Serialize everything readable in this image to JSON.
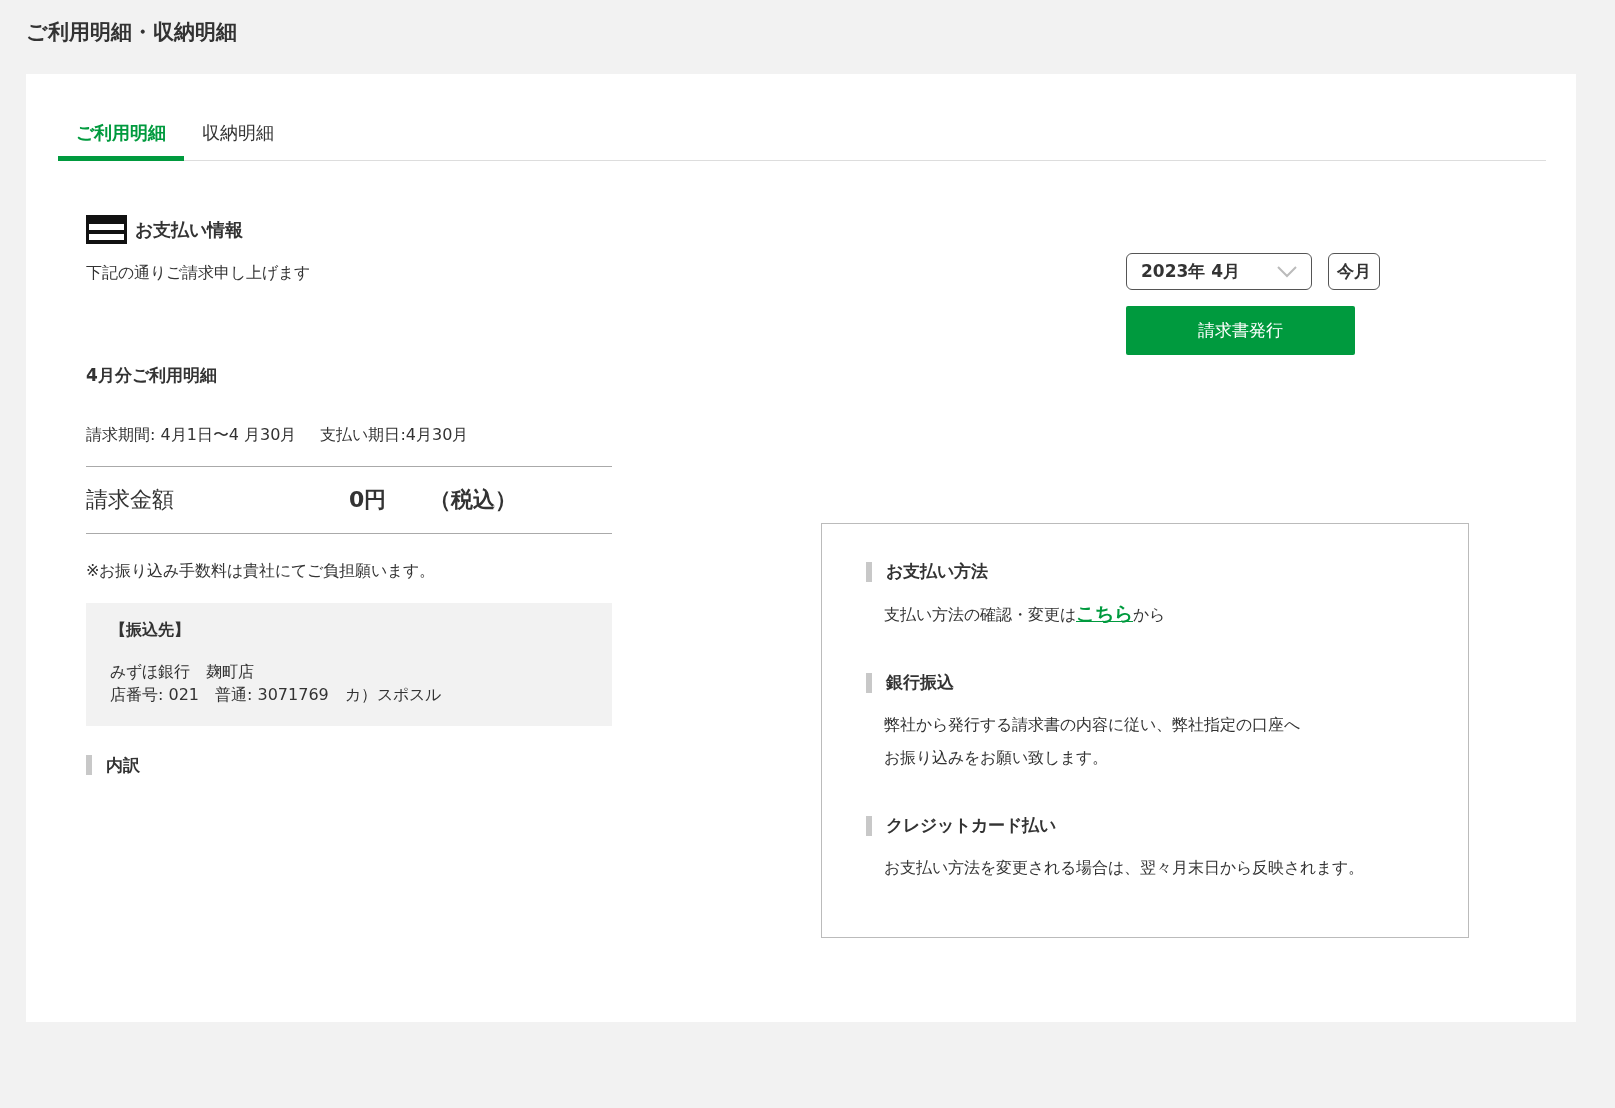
{
  "page_title": "ご利用明細・収納明細",
  "tabs": [
    {
      "label": "ご利用明細",
      "selected": true
    },
    {
      "label": "収納明細",
      "selected": false
    }
  ],
  "payment_info": {
    "heading": "お支払い情報",
    "subtitle": "下記の通りご請求申し上げます",
    "month_heading": "4月分ご利用明細",
    "period": "請求期間: 4月1日〜4 月30月",
    "due": "支払い期日:4月30月",
    "amount_label": "請求金額",
    "amount": "0円",
    "tax": "（税込）",
    "fee_note": "※お振り込み手数料は貴社にてご負担願います。",
    "transfer": {
      "heading": "【振込先】",
      "lines": [
        "みずほ銀行　麹町店",
        "店番号: 021　普通: 3071769　カ）スポスル"
      ]
    },
    "breakdown_heading": "内訳"
  },
  "controls": {
    "month_select": "2023年 4月",
    "this_month_button": "今月",
    "invoice_button": "請求書発行"
  },
  "methods": [
    {
      "heading": "お支払い方法",
      "kind": "link",
      "text_before": "支払い方法の確認・変更は",
      "link": "こちら",
      "text_after": "から"
    },
    {
      "heading": "銀行振込",
      "kind": "text",
      "lines": [
        "弊社から発行する請求書の内容に従い、弊社指定の口座へ",
        "お振り込みをお願い致します。"
      ]
    },
    {
      "heading": "クレジットカード払い",
      "kind": "text",
      "lines": [
        "お支払い方法を変更される場合は、翌々月末日から反映されます。"
      ]
    }
  ]
}
